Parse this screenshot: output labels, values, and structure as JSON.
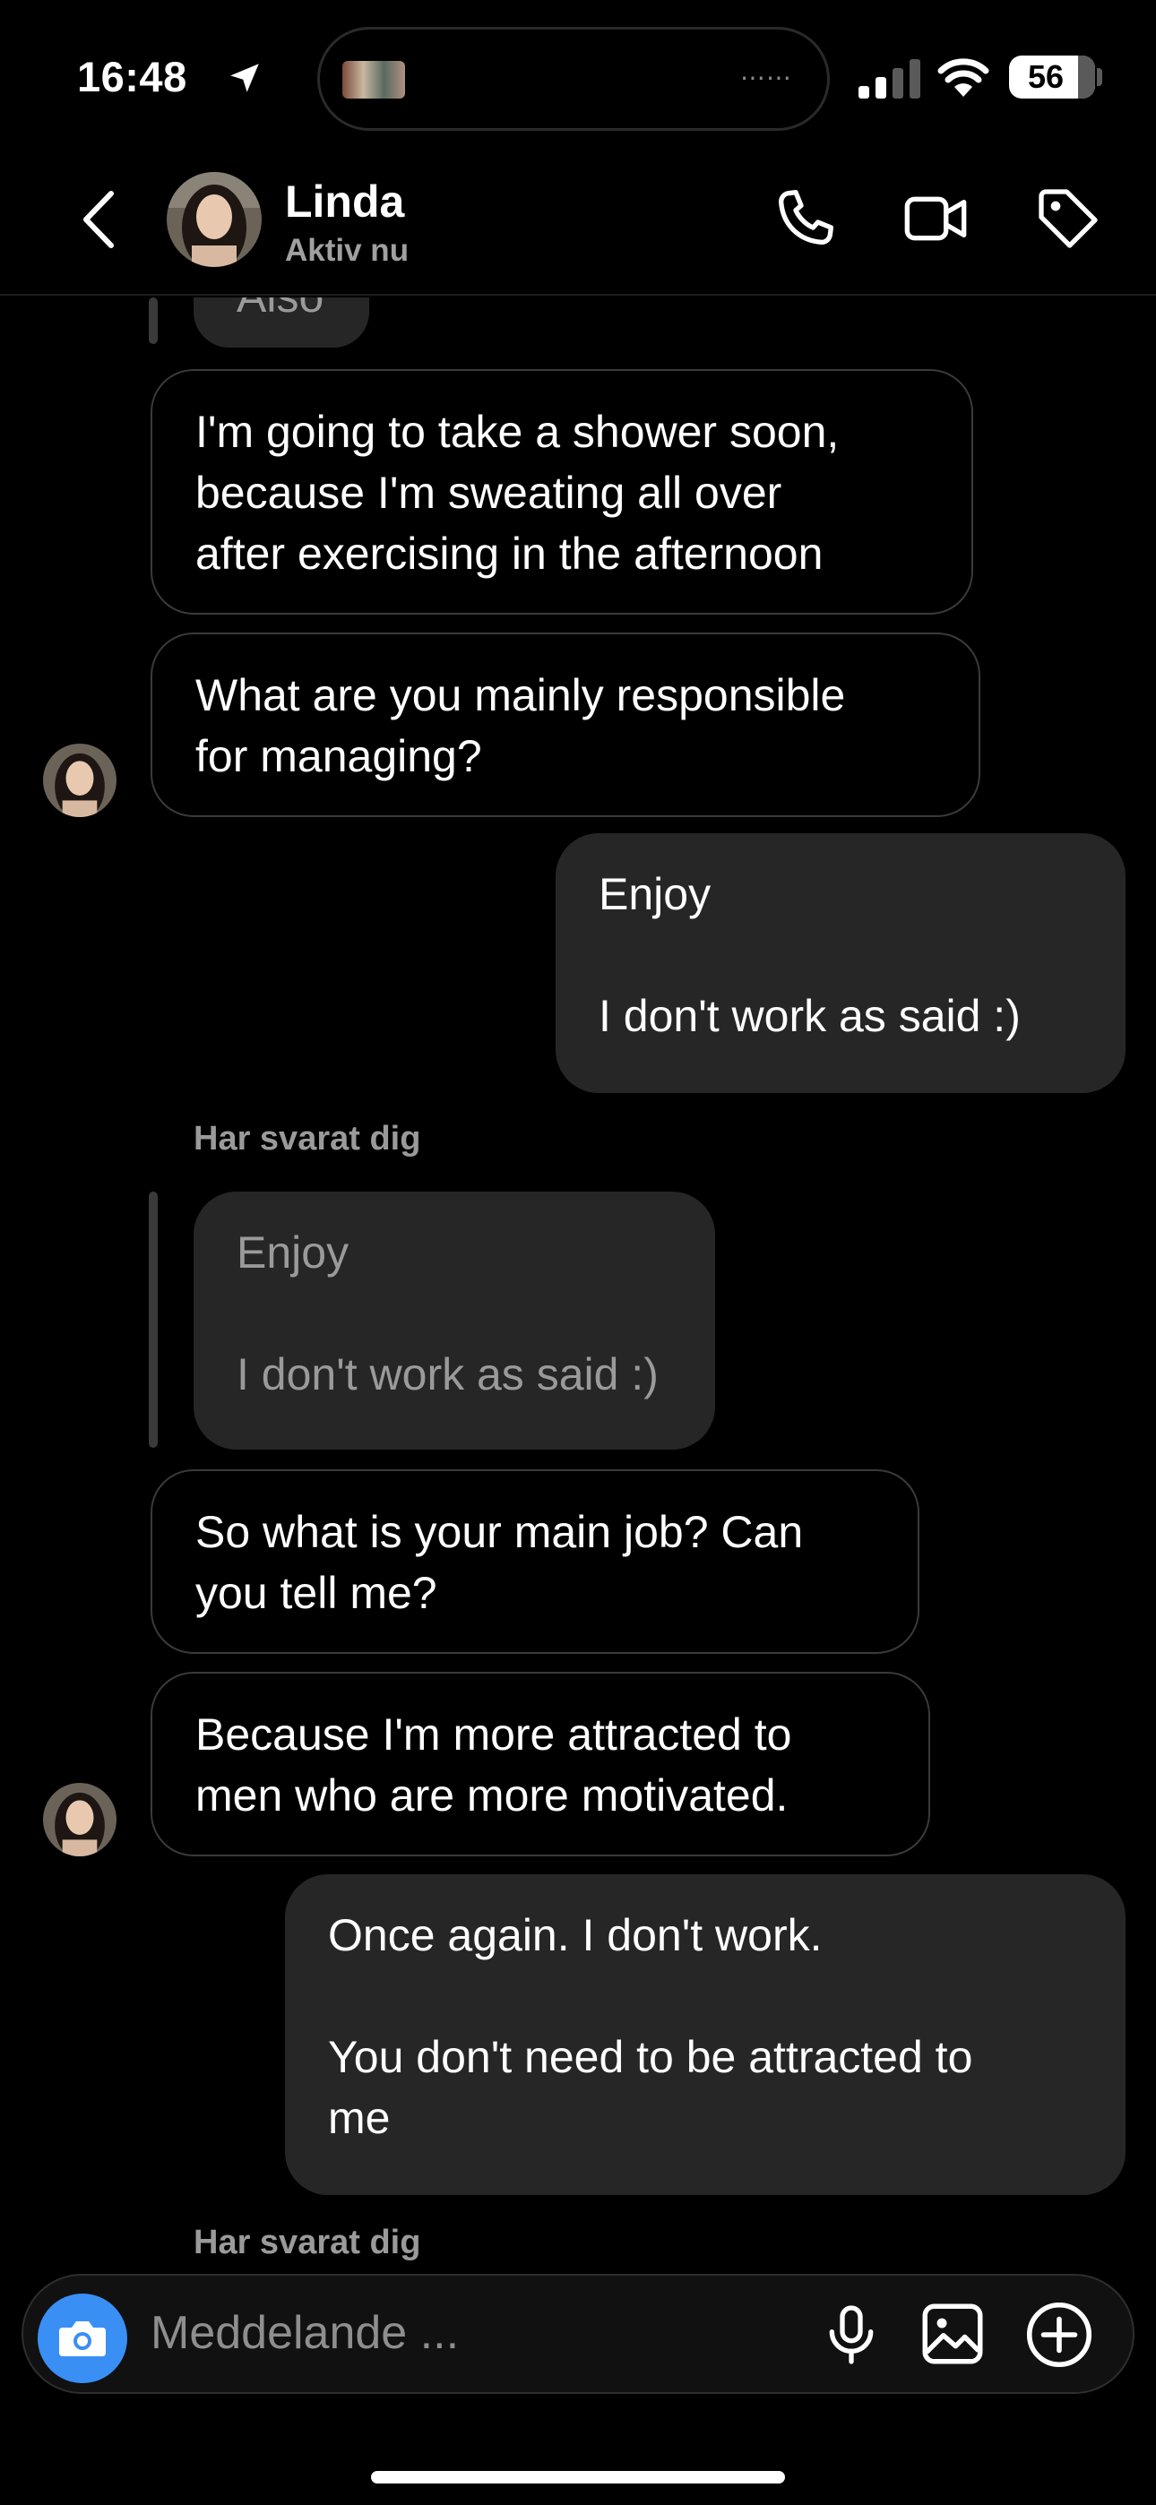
{
  "status_bar": {
    "time": "16:48",
    "battery": "56",
    "battery_level": 0.56,
    "icons": [
      "location-arrow-icon",
      "signal-icon",
      "wifi-icon",
      "battery-icon"
    ],
    "island_dots": "⋯⋯"
  },
  "header": {
    "contact_name": "Linda",
    "contact_status": "Aktiv nu",
    "icons": [
      "back-chevron-icon",
      "phone-icon",
      "video-icon",
      "tag-icon"
    ]
  },
  "messages": {
    "partial_top": "Also",
    "m1": "I'm going to take a shower soon,\nbecause I'm sweating all over\nafter exercising in the afternoon",
    "m2": "What are you mainly responsible\nfor managing?",
    "m3": "Enjoy\n\nI don't work as said :)",
    "reply_label_1": "Har svarat dig",
    "quote1": "Enjoy\n\nI don't work as said :)",
    "m4": "So what is your main job? Can\nyou tell me?",
    "m5": "Because I'm more attracted to\nmen who are more motivated.",
    "m6": "Once again. I don't work.\n\nYou don't need to be attracted to\nme",
    "reply_label_2": "Har svarat dig"
  },
  "composer": {
    "placeholder": "Meddelande ...",
    "icons": [
      "camera-icon",
      "microphone-icon",
      "image-icon",
      "add-circle-icon"
    ]
  },
  "colors": {
    "background": "#000000",
    "outgoing_bubble": "#262626",
    "incoming_border": "#3a3a3a",
    "camera_button": "#3a8ff5",
    "muted_text": "#9a9a9a"
  }
}
